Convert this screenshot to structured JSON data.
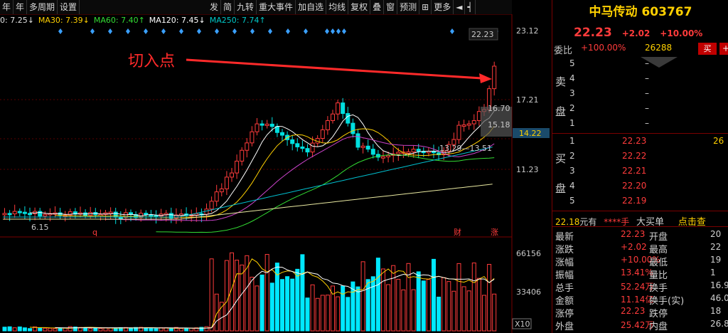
{
  "toolbar": {
    "left": [
      "年",
      "年",
      "多周期",
      "设置"
    ],
    "right": [
      "发",
      "简",
      "九转",
      "重大事件",
      "加自选",
      "均线",
      "复权",
      "叠",
      "窗",
      "预测",
      "",
      "更多"
    ]
  },
  "ma": [
    {
      "label": "0: 7.25↓",
      "color": "#e0e0e0"
    },
    {
      "label": "MA30: 7.39↓",
      "color": "#ffd000"
    },
    {
      "label": "MA60: 7.40↑",
      "color": "#33dd33"
    },
    {
      "label": "MA120: 7.45↓",
      "color": "#ffffff"
    },
    {
      "label": "MA250: 7.74↑",
      "color": "#00c8c8"
    }
  ],
  "annotation": "切入点",
  "axis": {
    "price": [
      "23.12",
      "17.21",
      "14.22",
      "11.23"
    ],
    "volume": [
      "66156",
      "33406",
      "X10"
    ],
    "high_label": "22.23",
    "range_high": "16.70",
    "range_mid": "15.18",
    "range_low": "13.29—13.51",
    "low_label": "6.15",
    "marker_q": "q",
    "marker_cai": "财",
    "marker_zhang": "涨"
  },
  "chart_data": {
    "type": "candlestick",
    "price_axis_ticks": [
      23.12,
      17.21,
      14.22,
      11.23
    ],
    "volume_axis_ticks": [
      66156,
      33406
    ],
    "last_close": 22.23,
    "annotations": [
      "切入点",
      "22.23",
      "16.70",
      "15.18",
      "13.29—13.51",
      "6.15"
    ]
  },
  "stock": {
    "title": "中马传动 603767",
    "price": "22.23",
    "change": "+2.02",
    "pct": "+10.00%"
  },
  "weibi": {
    "label": "委比",
    "value": "+100.00%",
    "count": "26288",
    "sell_btn": "买",
    "plus_btn": "+"
  },
  "sell": {
    "label_top": "卖",
    "label_bottom": "盘",
    "levels": [
      {
        "n": "5",
        "p": "",
        "v": "–"
      },
      {
        "n": "4",
        "p": "",
        "v": "–"
      },
      {
        "n": "3",
        "p": "",
        "v": "–"
      },
      {
        "n": "2",
        "p": "",
        "v": "–"
      },
      {
        "n": "1",
        "p": "",
        "v": "–"
      }
    ]
  },
  "buy": {
    "label_top": "买",
    "label_bottom": "盘",
    "levels": [
      {
        "n": "1",
        "p": "22.23",
        "v": "26"
      },
      {
        "n": "2",
        "p": "22.22",
        "v": ""
      },
      {
        "n": "3",
        "p": "22.21",
        "v": ""
      },
      {
        "n": "4",
        "p": "22.20",
        "v": ""
      },
      {
        "n": "5",
        "p": "22.19",
        "v": ""
      }
    ]
  },
  "trade": {
    "price": "22.18",
    "unit": "元有",
    "stars": "****手",
    "tag": "大买单",
    "link": "点击查"
  },
  "stats": [
    {
      "k": "最新",
      "v": "22.23",
      "k2": "开盘",
      "v2": "20"
    },
    {
      "k": "涨跌",
      "v": "+2.02",
      "k2": "最高",
      "v2": "22"
    },
    {
      "k": "涨幅",
      "v": "+10.00%",
      "k2": "最低",
      "v2": "19"
    },
    {
      "k": "振幅",
      "v": "13.41%",
      "k2": "量比",
      "v2": "1"
    },
    {
      "k": "总手",
      "v": "52.24万",
      "k2": "换手",
      "v2": "16.9"
    },
    {
      "k": "金额",
      "v": "11.14亿",
      "k2": "换手(实)",
      "v2": "46.0"
    },
    {
      "k": "涨停",
      "v": "22.23",
      "k2": "跌停",
      "v2": "18"
    },
    {
      "k": "外盘",
      "v": "25.42万",
      "k2": "内盘",
      "v2": "26.8"
    }
  ]
}
